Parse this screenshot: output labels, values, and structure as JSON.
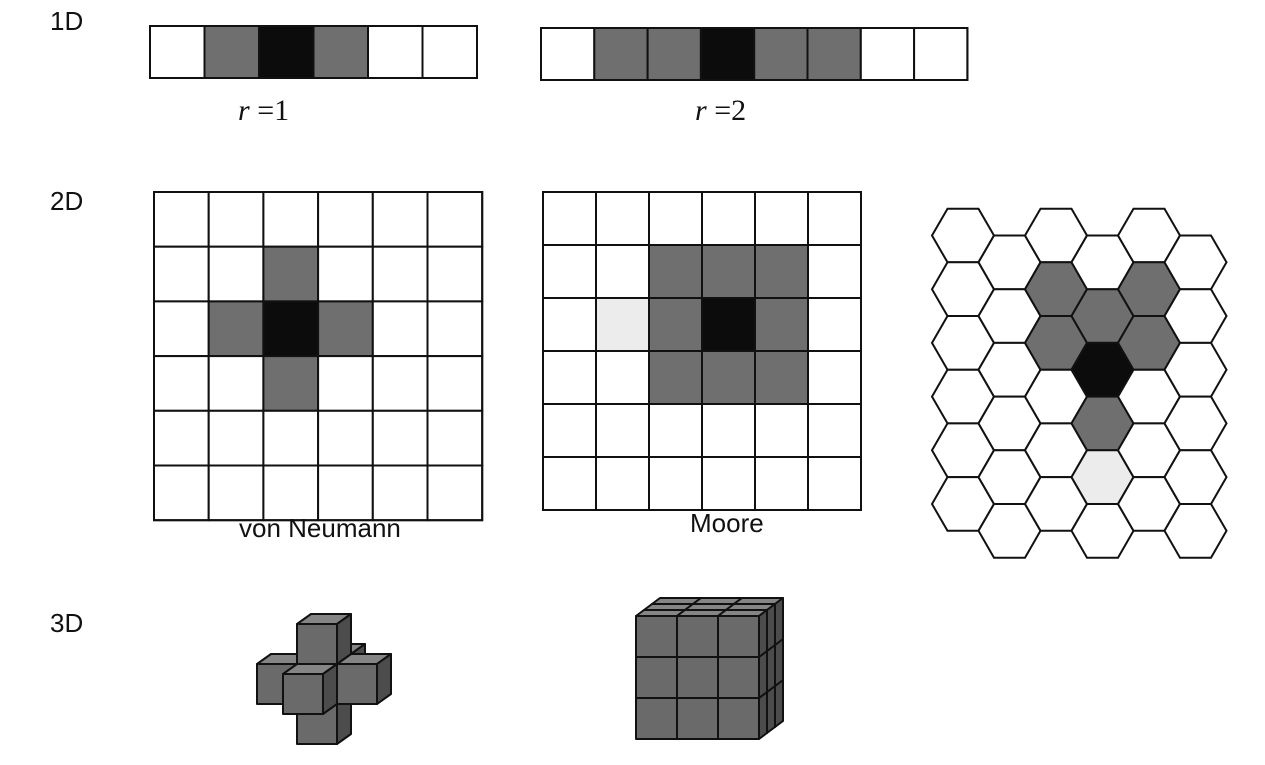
{
  "rows": [
    {
      "id": "1d",
      "label": "1D"
    },
    {
      "id": "2d",
      "label": "2D"
    },
    {
      "id": "3d",
      "label": "3D"
    }
  ],
  "one_d": [
    {
      "id": "r1",
      "var": "r",
      "rest": " =1",
      "cells": [
        "empty",
        "neighbor",
        "center",
        "neighbor",
        "empty",
        "empty"
      ]
    },
    {
      "id": "r2",
      "var": "r",
      "rest": " =2",
      "cells": [
        "empty",
        "neighbor",
        "neighbor",
        "center",
        "neighbor",
        "neighbor",
        "empty",
        "empty"
      ]
    }
  ],
  "two_d": [
    {
      "id": "von-neumann",
      "caption": "von Neumann",
      "size": 6,
      "cells": [
        [
          2,
          1,
          "neighbor"
        ],
        [
          1,
          2,
          "neighbor"
        ],
        [
          2,
          2,
          "center"
        ],
        [
          3,
          2,
          "neighbor"
        ],
        [
          2,
          3,
          "neighbor"
        ]
      ]
    },
    {
      "id": "moore",
      "caption": "Moore",
      "size": 6,
      "cells": [
        [
          2,
          1,
          "neighbor"
        ],
        [
          3,
          1,
          "neighbor"
        ],
        [
          4,
          1,
          "neighbor"
        ],
        [
          2,
          2,
          "neighbor"
        ],
        [
          3,
          2,
          "center"
        ],
        [
          4,
          2,
          "neighbor"
        ],
        [
          2,
          3,
          "neighbor"
        ],
        [
          3,
          3,
          "neighbor"
        ],
        [
          4,
          3,
          "neighbor"
        ],
        [
          1,
          2,
          "faint"
        ]
      ]
    },
    {
      "id": "hexagonal",
      "caption": "",
      "cols": 6,
      "rows": 6,
      "cells": [
        [
          3,
          2,
          "center"
        ],
        [
          3,
          1,
          "neighbor"
        ],
        [
          3,
          3,
          "neighbor"
        ],
        [
          2,
          1,
          "neighbor"
        ],
        [
          2,
          2,
          "neighbor"
        ],
        [
          4,
          1,
          "neighbor"
        ],
        [
          4,
          2,
          "neighbor"
        ],
        [
          3,
          4,
          "faint"
        ]
      ]
    }
  ],
  "three_d": [
    {
      "id": "3d-von-neumann",
      "cubes": [
        [
          0,
          0,
          -1
        ],
        [
          -1,
          0,
          0
        ],
        [
          0,
          -1,
          0
        ],
        [
          0,
          0,
          0
        ],
        [
          0,
          1,
          0
        ],
        [
          1,
          0,
          0
        ],
        [
          0,
          0,
          1
        ]
      ]
    },
    {
      "id": "3d-moore",
      "dims": [
        3,
        3,
        3
      ]
    }
  ],
  "colors": {
    "empty": "#ffffff",
    "neighbor": "#6f6f6f",
    "center": "#0c0c0c",
    "faint": "#ececec",
    "cube_front": "#6a6a6a",
    "cube_top": "#858585",
    "cube_side": "#4c4c4c",
    "line": "#111111"
  }
}
